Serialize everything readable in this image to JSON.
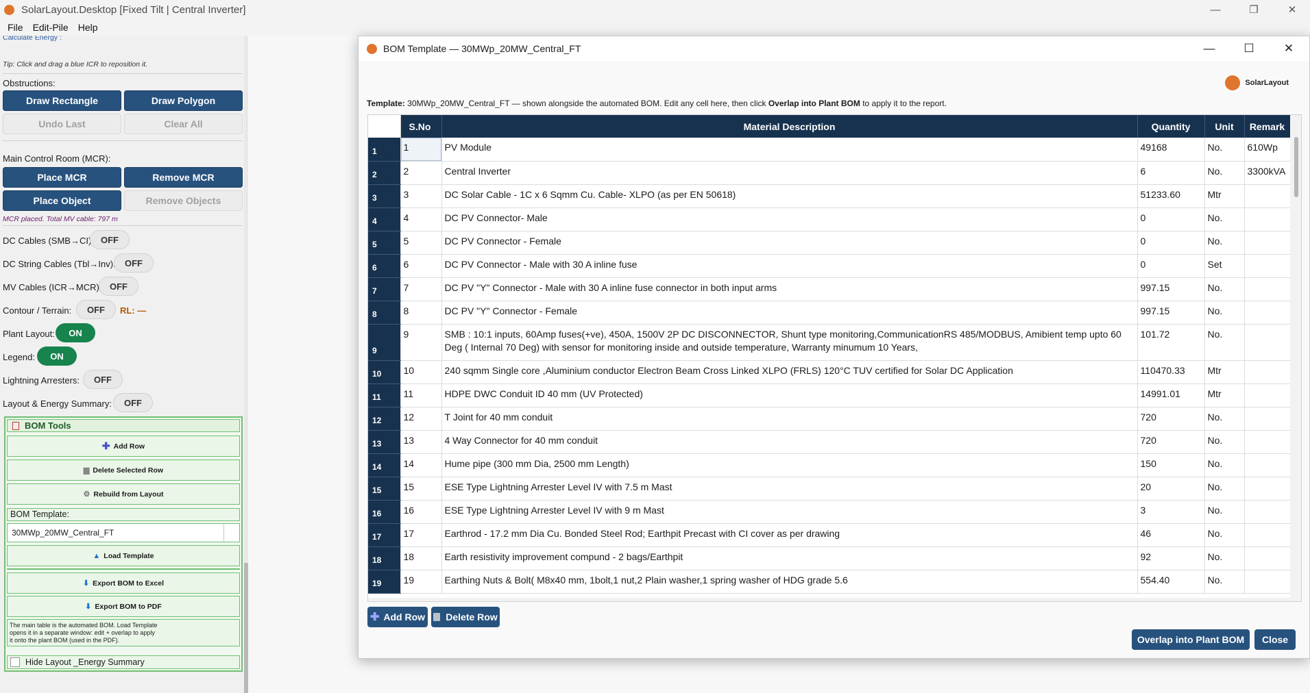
{
  "window": {
    "title": "SolarLayout.Desktop  [Fixed Tilt  |  Central Inverter]",
    "minimize": "—",
    "maximize": "❐",
    "close": "✕"
  },
  "menu": [
    "File",
    "Edit-Pile",
    "Help"
  ],
  "left_panel": {
    "calc_energy_cut": "Calculate Energy :",
    "tip": "Tip: Click and drag a blue ICR to reposition it.",
    "obstructions_label": "Obstructions:",
    "draw_rectangle": "Draw Rectangle",
    "draw_polygon": "Draw Polygon",
    "undo_last": "Undo Last",
    "clear_all": "Clear All",
    "mcr_label": "Main Control Room (MCR):",
    "place_mcr": "Place MCR",
    "remove_mcr": "Remove MCR",
    "place_object": "Place Object",
    "remove_objects": "Remove Objects",
    "mcr_status": "MCR placed. Total MV cable: 797 m",
    "toggles": [
      {
        "label": "DC Cables (SMB→CI):",
        "state": "OFF"
      },
      {
        "label": "DC String Cables (Tbl→Inv):",
        "state": "OFF"
      },
      {
        "label": "MV Cables (ICR→MCR):",
        "state": "OFF"
      },
      {
        "label": "Contour / Terrain:",
        "state": "OFF"
      },
      {
        "label": "Plant Layout:",
        "state": "ON"
      },
      {
        "label": "Legend:",
        "state": "ON"
      },
      {
        "label": "Lightning Arresters:",
        "state": "OFF"
      },
      {
        "label": "Layout & Energy Summary:",
        "state": "OFF"
      }
    ],
    "rl_label": "RL: —",
    "bom_tools": {
      "header": "BOM Tools",
      "add_row": "Add Row",
      "delete_selected_row": "Delete Selected Row",
      "rebuild_from_layout": "Rebuild from Layout",
      "template_label": "BOM Template:",
      "template_value": "30MWp_20MW_Central_FT",
      "load_template": "Load Template",
      "export_excel": "Export BOM to Excel",
      "export_pdf": "Export BOM to PDF",
      "note_1": "The main table is the automated BOM. Load Template",
      "note_2": "opens it in a separate window: edit + overlap to apply",
      "note_3": "it onto the plant BOM (used in the PDF).",
      "hide_summary": "Hide Layout _Energy Summary"
    }
  },
  "dialog": {
    "title": "BOM Template — 30MWp_20MW_Central_FT",
    "minimize": "—",
    "maximize": "☐",
    "close": "✕",
    "brand": "SolarLayout",
    "template_prefix": "Template:",
    "template_name": "30MWp_20MW_Central_FT",
    "template_mid": " —  shown alongside the automated BOM. Edit any cell here, then click ",
    "template_action": "Overlap into Plant BOM",
    "template_suffix": " to apply it to the report.",
    "columns": [
      "S.No",
      "Material Description",
      "Quantity",
      "Unit",
      "Remark"
    ],
    "rows": [
      {
        "n": "1",
        "sno": "1",
        "desc": "PV Module",
        "qty": "49168",
        "unit": "No.",
        "remark": "610Wp"
      },
      {
        "n": "2",
        "sno": "2",
        "desc": "Central Inverter",
        "qty": "6",
        "unit": "No.",
        "remark": "3300kVA"
      },
      {
        "n": "3",
        "sno": "3",
        "desc": "DC Solar Cable - 1C x 6 Sqmm Cu. Cable- XLPO (as per EN 50618)",
        "qty": "51233.60",
        "unit": "Mtr",
        "remark": ""
      },
      {
        "n": "4",
        "sno": "4",
        "desc": "DC PV Connector- Male",
        "qty": "0",
        "unit": "No.",
        "remark": ""
      },
      {
        "n": "5",
        "sno": "5",
        "desc": "DC PV Connector - Female",
        "qty": "0",
        "unit": "No.",
        "remark": ""
      },
      {
        "n": "6",
        "sno": "6",
        "desc": "DC PV Connector - Male with 30 A inline fuse",
        "qty": "0",
        "unit": "Set",
        "remark": ""
      },
      {
        "n": "7",
        "sno": "7",
        "desc": "DC PV \"Y\"  Connector - Male with 30 A inline fuse connector in both input arms",
        "qty": "997.15",
        "unit": "No.",
        "remark": ""
      },
      {
        "n": "8",
        "sno": "8",
        "desc": "DC PV \"Y\" Connector - Female",
        "qty": "997.15",
        "unit": "No.",
        "remark": ""
      },
      {
        "n": "9",
        "sno": "9",
        "desc": "SMB : 10:1 inputs, 60Amp fuses(+ve), 450A, 1500V 2P DC DISCONNECTOR, Shunt type monitoring,CommunicationRS 485/MODBUS, Amibient temp upto 60 Deg ( Internal 70 Deg) with sensor for monitoring inside and outside temperature, Warranty minumum 10 Years,",
        "qty": "101.72",
        "unit": "No.",
        "remark": ""
      },
      {
        "n": "10",
        "sno": "10",
        "desc": "240 sqmm Single core ,Aluminium conductor Electron Beam Cross Linked XLPO (FRLS) 120°C TUV certified for Solar DC  Application",
        "qty": "110470.33",
        "unit": "Mtr",
        "remark": ""
      },
      {
        "n": "11",
        "sno": "11",
        "desc": "HDPE DWC Conduit ID 40 mm (UV Protected)",
        "qty": "14991.01",
        "unit": "Mtr",
        "remark": ""
      },
      {
        "n": "12",
        "sno": "12",
        "desc": "T Joint for 40 mm conduit",
        "qty": "720",
        "unit": "No.",
        "remark": ""
      },
      {
        "n": "13",
        "sno": "13",
        "desc": "4 Way Connector for 40 mm conduit",
        "qty": "720",
        "unit": "No.",
        "remark": ""
      },
      {
        "n": "14",
        "sno": "14",
        "desc": "Hume pipe (300 mm Dia, 2500 mm Length)",
        "qty": "150",
        "unit": "No.",
        "remark": ""
      },
      {
        "n": "15",
        "sno": "15",
        "desc": "ESE Type Lightning Arrester Level IV with 7.5 m Mast",
        "qty": "20",
        "unit": "No.",
        "remark": ""
      },
      {
        "n": "16",
        "sno": "16",
        "desc": "ESE Type Lightning Arrester Level IV with 9 m Mast",
        "qty": "3",
        "unit": "No.",
        "remark": ""
      },
      {
        "n": "17",
        "sno": "17",
        "desc": "Earthrod -  17.2 mm Dia Cu. Bonded Steel Rod; Earthpit Precast with CI cover as per drawing",
        "qty": "46",
        "unit": "No.",
        "remark": ""
      },
      {
        "n": "18",
        "sno": "18",
        "desc": "Earth resistivity improvement compund - 2 bags/Earthpit",
        "qty": "92",
        "unit": "No.",
        "remark": ""
      },
      {
        "n": "19",
        "sno": "19",
        "desc": "Earthing Nuts & Bolt( M8x40 mm, 1bolt,1 nut,2 Plain washer,1 spring washer of HDG grade 5.6",
        "qty": "554.40",
        "unit": "No.",
        "remark": ""
      }
    ],
    "add_row": "Add Row",
    "delete_row": "Delete Row",
    "overlap": "Overlap into Plant BOM",
    "close_btn": "Close"
  },
  "colors": {
    "accent_blue": "#27527e",
    "table_header": "#17324f",
    "toggle_on": "#17834d",
    "brand_orange": "#e0752e",
    "bom_green": "#6fbf73"
  }
}
